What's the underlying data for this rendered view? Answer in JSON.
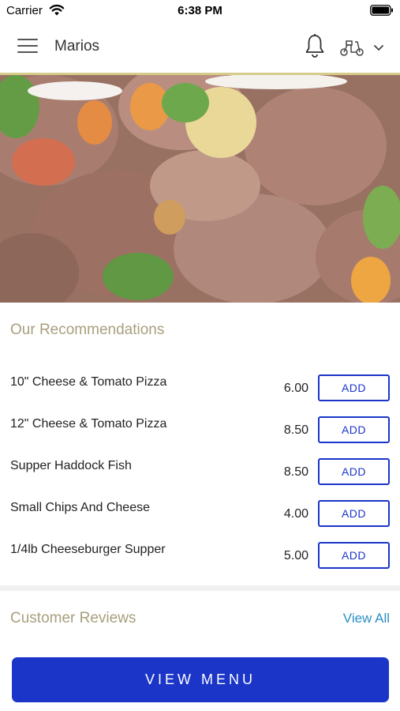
{
  "status_bar": {
    "carrier": "Carrier",
    "time": "6:38 PM"
  },
  "header": {
    "title": "Marios",
    "icons": {
      "menu": "hamburger-menu-icon",
      "notifications": "bell-icon",
      "order_mode": "scooter-delivery-icon",
      "dropdown": "chevron-down-icon"
    }
  },
  "hero": {
    "image": "grilled meat kebab skewers with peppers and parsley"
  },
  "recommendations": {
    "title": "Our Recommendations",
    "items": [
      {
        "name": "10\" Cheese & Tomato Pizza",
        "price": "6.00",
        "add_label": "ADD"
      },
      {
        "name": "12\" Cheese & Tomato Pizza",
        "price": "8.50",
        "add_label": "ADD"
      },
      {
        "name": "Supper Haddock Fish",
        "price": "8.50",
        "add_label": "ADD"
      },
      {
        "name": "Small Chips And Cheese",
        "price": "4.00",
        "add_label": "ADD"
      },
      {
        "name": "1/4lb Cheeseburger Supper",
        "price": "5.00",
        "add_label": "ADD"
      }
    ]
  },
  "reviews": {
    "title": "Customer Reviews",
    "view_all_label": "View All"
  },
  "footer": {
    "view_menu_label": "VIEW MENU"
  },
  "colors": {
    "accent_gold": "#a89f7e",
    "primary_blue": "#1a35c8",
    "link_blue": "#2a8fc7",
    "header_accent": "#d6cc8a"
  }
}
